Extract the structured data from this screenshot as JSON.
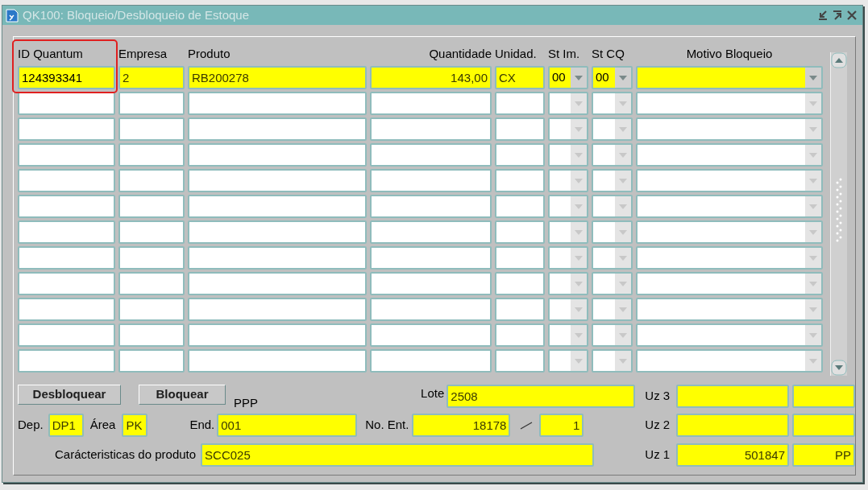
{
  "window": {
    "title": "QK100: Bloqueio/Desbloqueio de Estoque"
  },
  "table": {
    "columns": [
      {
        "label": "ID Quantum",
        "kind": "text",
        "highlighted": true
      },
      {
        "label": "Empresa",
        "kind": "text",
        "highlighted": false
      },
      {
        "label": "Produto",
        "kind": "text",
        "highlighted": false
      },
      {
        "label": "Quantidade",
        "kind": "number",
        "highlighted": false
      },
      {
        "label": "Unidad.",
        "kind": "text",
        "highlighted": false
      },
      {
        "label": "St Im.",
        "kind": "dropdown",
        "highlighted": false
      },
      {
        "label": "St CQ",
        "kind": "dropdown",
        "highlighted": false
      },
      {
        "label": "Motivo Bloqueio",
        "kind": "dropdown",
        "highlighted": false
      }
    ],
    "rows": [
      {
        "current": true,
        "cells": [
          "124393341",
          "2",
          "RB200278",
          "143,00",
          "CX",
          "00",
          "00"
        ]
      },
      {
        "current": false
      },
      {
        "current": false
      },
      {
        "current": false
      },
      {
        "current": false
      },
      {
        "current": false
      },
      {
        "current": false
      },
      {
        "current": false
      },
      {
        "current": false
      },
      {
        "current": false
      },
      {
        "current": false
      },
      {
        "current": false
      }
    ]
  },
  "buttons": [
    "Desbloquear",
    "Bloquear"
  ],
  "ppp_label": "PPP",
  "lote": {
    "label": "Lote",
    "value": "2508"
  },
  "dep": {
    "label": "Dep.",
    "value": "DP1"
  },
  "area": {
    "label": "Área",
    "value": "PK"
  },
  "end": {
    "label": "End.",
    "value": "001"
  },
  "no_ent": {
    "label": "No. Ent.",
    "value": "18178",
    "sequence": "1"
  },
  "caracteristicas": {
    "label": "Carácteristicas do produto",
    "value": "SCC025"
  },
  "uz": [
    {
      "label": "Uz",
      "number": "3"
    },
    {
      "label": "Uz",
      "number": "2"
    },
    {
      "label": "Uz",
      "number": "1",
      "value": "501847",
      "unit": "PP"
    }
  ]
}
